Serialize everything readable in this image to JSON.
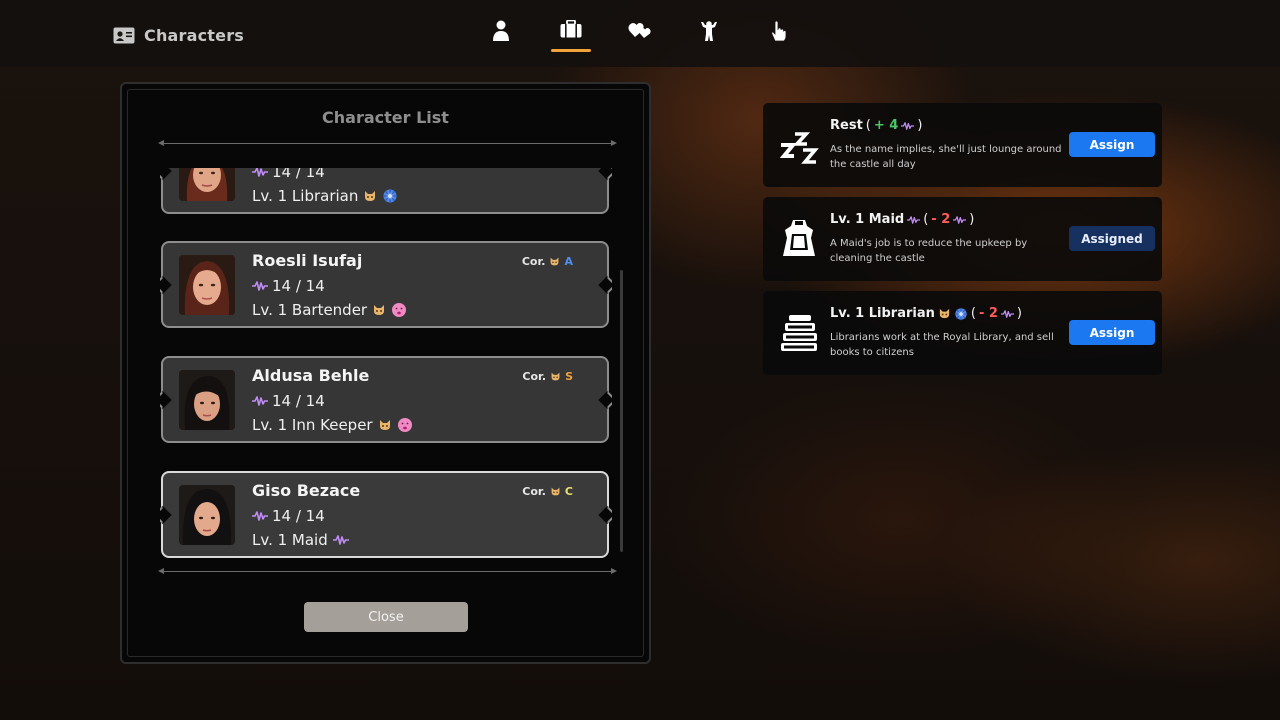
{
  "header": {
    "title": "Characters",
    "tabs": [
      {
        "icon": "person-icon",
        "active": false
      },
      {
        "icon": "briefcase-icon",
        "active": true
      },
      {
        "icon": "hearts-icon",
        "active": false
      },
      {
        "icon": "flexing-figure-icon",
        "active": false
      },
      {
        "icon": "pointing-hand-icon",
        "active": false
      }
    ]
  },
  "panel": {
    "title": "Character List",
    "close_label": "Close"
  },
  "characters": [
    {
      "name": "",
      "stamina": "14 / 14",
      "job": "Lv. 1 Librarian",
      "job_icons": [
        "cat-icon",
        "gear-flower-icon"
      ],
      "corruption_label": "",
      "corruption_grade": "",
      "partial": true
    },
    {
      "name": "Roesli Isufaj",
      "stamina": "14 / 14",
      "job": "Lv. 1 Bartender",
      "job_icons": [
        "cat-icon",
        "kiss-face-icon"
      ],
      "corruption_label": "Cor.",
      "corruption_grade": "A",
      "grade_color": "#4f8ef0"
    },
    {
      "name": "Aldusa Behle",
      "stamina": "14 / 14",
      "job": "Lv. 1 Inn Keeper",
      "job_icons": [
        "cat-icon",
        "kiss-face-icon"
      ],
      "corruption_label": "Cor.",
      "corruption_grade": "S",
      "grade_color": "#f0a040"
    },
    {
      "name": "Giso Bezace",
      "stamina": "14 / 14",
      "job": "Lv. 1 Maid",
      "job_icons": [
        "pulse-icon"
      ],
      "corruption_label": "Cor.",
      "corruption_grade": "C",
      "grade_color": "#e8e070",
      "selected": true
    }
  ],
  "jobs": [
    {
      "title": "Rest",
      "delta": "+ 4",
      "delta_type": "plus",
      "icon": "sleep-zzz-icon",
      "title_icons": [],
      "description": "As the name implies, she'll just lounge around the castle all day",
      "button": "Assign",
      "button_state": "assign"
    },
    {
      "title": "Lv. 1 Maid",
      "delta": "- 2",
      "delta_type": "minus",
      "icon": "maid-dress-icon",
      "title_icons": [
        "pulse-icon"
      ],
      "description": "A Maid's job is to reduce the upkeep by cleaning the castle",
      "button": "Assigned",
      "button_state": "assigned"
    },
    {
      "title": "Lv. 1 Librarian",
      "delta": "- 2",
      "delta_type": "minus",
      "icon": "book-stack-icon",
      "title_icons": [
        "cat-icon",
        "gear-flower-icon"
      ],
      "description": "Librarians work at the Royal Library, and sell books to citizens",
      "button": "Assign",
      "button_state": "assign"
    }
  ],
  "colors": {
    "tab_active_underline": "#f2a33a",
    "assign_button": "#1b78f0",
    "assigned_button": "#16305f",
    "stamina_pulse": "#c08cf5"
  }
}
